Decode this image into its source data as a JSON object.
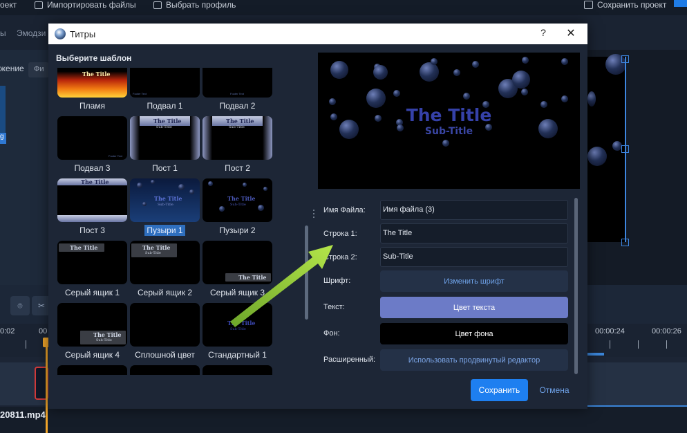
{
  "app": {
    "top_menu": {
      "project": "оект",
      "import": "Импортировать файлы",
      "profile": "Выбрать профиль",
      "save_project": "Сохранить проект"
    },
    "tabs": [
      "ы",
      "Эмодзи"
    ],
    "left_panel": {
      "chip": "жение",
      "chip2": "Фи",
      "selected_label": "g"
    },
    "timeline": {
      "labels": [
        "0:02",
        "00",
        "00:00:24",
        "00:00:26"
      ],
      "file_name": "20811.mp4"
    }
  },
  "dialog": {
    "title": "Титры",
    "help": "?",
    "close": "✕",
    "section_title": "Выберите шаблон",
    "templates": [
      {
        "label": "Пламя",
        "thumb": "flame",
        "thumb_title": "The Title"
      },
      {
        "label": "Подвал 1",
        "thumb": "footer",
        "footer_text": "Footer Text"
      },
      {
        "label": "Подвал 2",
        "thumb": "footer",
        "footer_text": "Footer Text"
      },
      {
        "label": "Подвал 3",
        "thumb": "footer-right",
        "footer_text": "Footer Text"
      },
      {
        "label": "Пост 1",
        "thumb": "post",
        "thumb_title": "The Title",
        "thumb_sub": "Sub-Title"
      },
      {
        "label": "Пост 2",
        "thumb": "post",
        "thumb_title": "The Title",
        "thumb_sub": "Sub-Title"
      },
      {
        "label": "Пост 3",
        "thumb": "post-dark",
        "thumb_title": "The Title"
      },
      {
        "label": "Пузыри 1",
        "thumb": "bubbles-blue",
        "thumb_title": "The Title",
        "thumb_sub": "Sub-Title",
        "selected": true
      },
      {
        "label": "Пузыри 2",
        "thumb": "bubbles-black",
        "thumb_title": "The Title",
        "thumb_sub": "Sub-Title"
      },
      {
        "label": "Серый ящик 1",
        "thumb": "grey-top",
        "thumb_title": "The Title"
      },
      {
        "label": "Серый ящик 2",
        "thumb": "grey-top2",
        "thumb_title": "The Title",
        "thumb_sub": "Sub-Title"
      },
      {
        "label": "Серый ящик 3",
        "thumb": "grey-bottom",
        "thumb_title": "The Title"
      },
      {
        "label": "Серый ящик 4",
        "thumb": "grey-bottom2",
        "thumb_title": "The Title",
        "thumb_sub": "Sub-Title"
      },
      {
        "label": "Сплошной цвет",
        "thumb": "solid"
      },
      {
        "label": "Стандартный 1",
        "thumb": "standard",
        "thumb_title": "The Title",
        "thumb_sub": "Sub-Title"
      }
    ],
    "preview": {
      "title": "The Title",
      "subtitle": "Sub-Title"
    },
    "fields": {
      "filename_label": "Имя Файла:",
      "filename_value": "Имя файла (3)",
      "line1_label": "Строка 1:",
      "line1_value": "The Title",
      "line2_label": "Строка 2:",
      "line2_value": "Sub-Title",
      "font_label": "Шрифт:",
      "font_button": "Изменить шрифт",
      "text_label": "Текст:",
      "text_button": "Цвет текста",
      "bg_label": "Фон:",
      "bg_button": "Цвет фона",
      "advanced_label": "Расширенный:",
      "advanced_button": "Использовать продвинутый редактор"
    },
    "buttons": {
      "save": "Сохранить",
      "cancel": "Отмена"
    },
    "colors": {
      "text_color": "#6c7bc7",
      "background_color": "#000000",
      "accent": "#1e7ff0",
      "arrow": "#9bd53a"
    }
  }
}
